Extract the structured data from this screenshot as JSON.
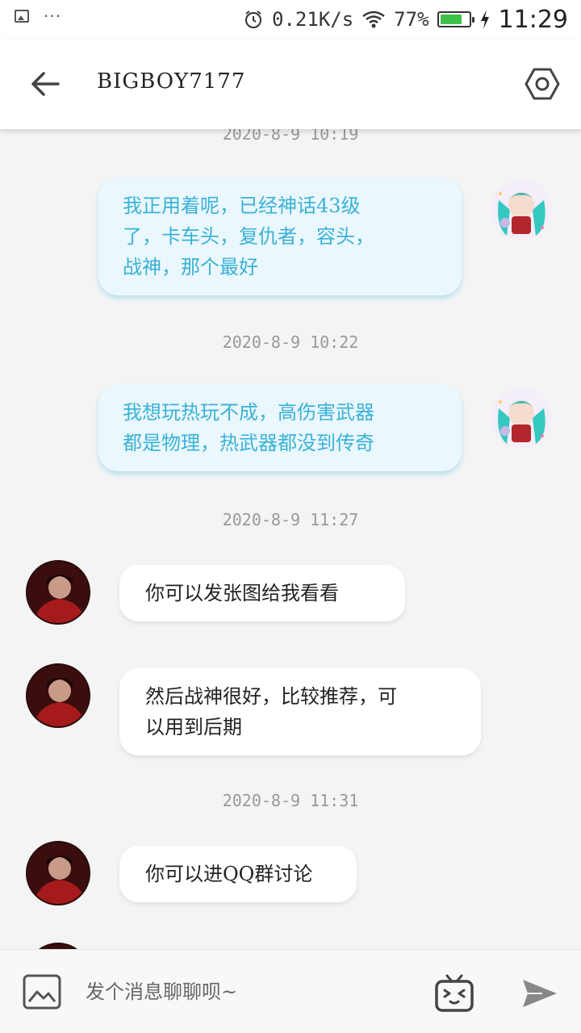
{
  "status_bar": {
    "net_speed": "0.21K/s",
    "battery_percent": "77%",
    "battery_level": 0.77,
    "time": "11:29",
    "icons": [
      "image-icon",
      "more-dots-icon",
      "alarm-icon",
      "wifi-icon",
      "battery-icon",
      "charging-icon"
    ]
  },
  "header": {
    "title": "BIGBOY7177",
    "icons": {
      "back": "arrow-left-icon",
      "settings": "hexagon-settings-icon"
    }
  },
  "messages": [
    {
      "type": "time",
      "text": "2020-8-9 10:19"
    },
    {
      "type": "out",
      "lines": [
        "我正用着呢，已经神话43级",
        "了，卡车头，复仇者，容头，",
        "战神，那个最好"
      ]
    },
    {
      "type": "time",
      "text": "2020-8-9 10:22"
    },
    {
      "type": "out",
      "lines": [
        "我想玩热玩不成，高伤害武器",
        "都是物理，热武器都没到传奇"
      ]
    },
    {
      "type": "time",
      "text": "2020-8-9 11:27"
    },
    {
      "type": "in",
      "lines": [
        "你可以发张图给我看看"
      ]
    },
    {
      "type": "in",
      "lines": [
        "然后战神很好，比较推荐，可",
        "以用到后期"
      ]
    },
    {
      "type": "time",
      "text": "2020-8-9 11:31"
    },
    {
      "type": "in",
      "lines": [
        "你可以进QQ群讨论"
      ]
    }
  ],
  "input_bar": {
    "placeholder": "发个消息聊聊呗~",
    "icons": {
      "image": "image-picker-icon",
      "emoji": "emoji-tv-icon",
      "send": "send-icon"
    }
  },
  "colors": {
    "outgoing_text": "#39b2d8",
    "outgoing_bubble": "#eaf7fc",
    "incoming_bubble": "#ffffff",
    "background": "#f4f4f4",
    "battery": "#3ec14a"
  }
}
